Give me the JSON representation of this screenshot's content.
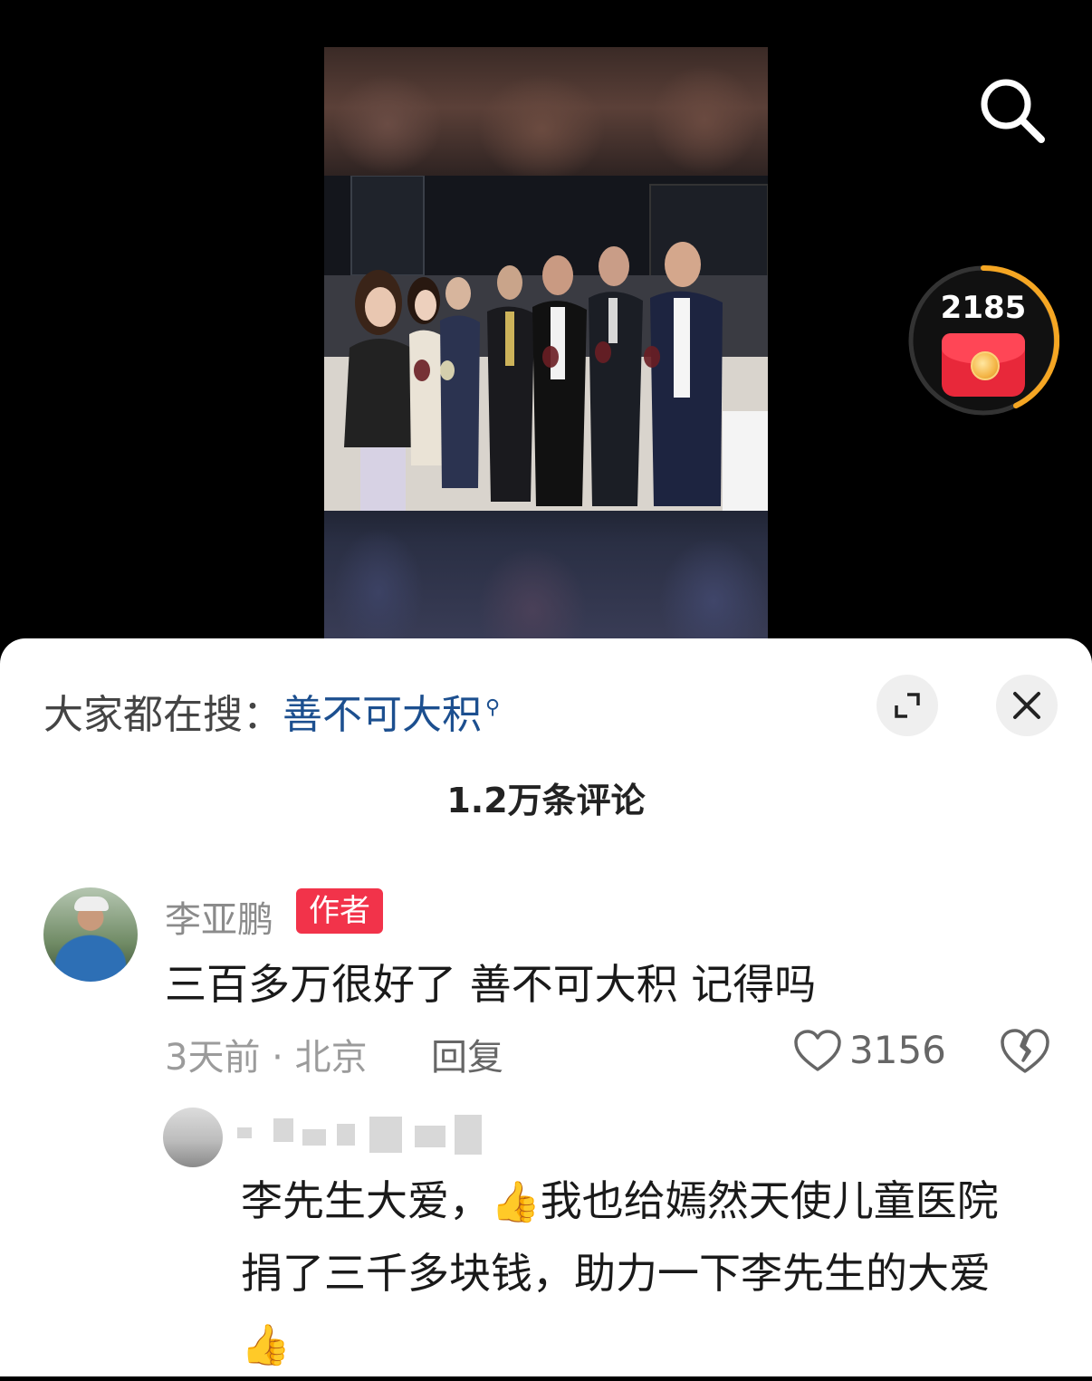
{
  "trending": {
    "prefix": "大家都在搜：",
    "keyword": "善不可大积"
  },
  "redpacket": {
    "count": "2185"
  },
  "comments_header": {
    "title": "1.2万条评论"
  },
  "comment": {
    "author": "李亚鹏",
    "badge": "作者",
    "text": "三百多万很好了 善不可大积  记得吗",
    "meta": "3天前 · 北京",
    "reply_label": "回复",
    "likes": "3156"
  },
  "reply": {
    "text_part1": "李先生大爱，",
    "thumb1": "👍",
    "text_part2": "我也给嫣然天使儿童医院捐了三千多块钱，助力一下李先生的大爱",
    "thumb2": "👍"
  },
  "colors": {
    "keyword": "#1c4f8f",
    "badge": "#f2334a",
    "redpacket": "#e8283a",
    "ring": "#f5a623"
  },
  "icons": [
    "search-icon",
    "red-envelope-icon",
    "expand-icon",
    "close-icon",
    "heart-icon",
    "broken-heart-icon"
  ]
}
